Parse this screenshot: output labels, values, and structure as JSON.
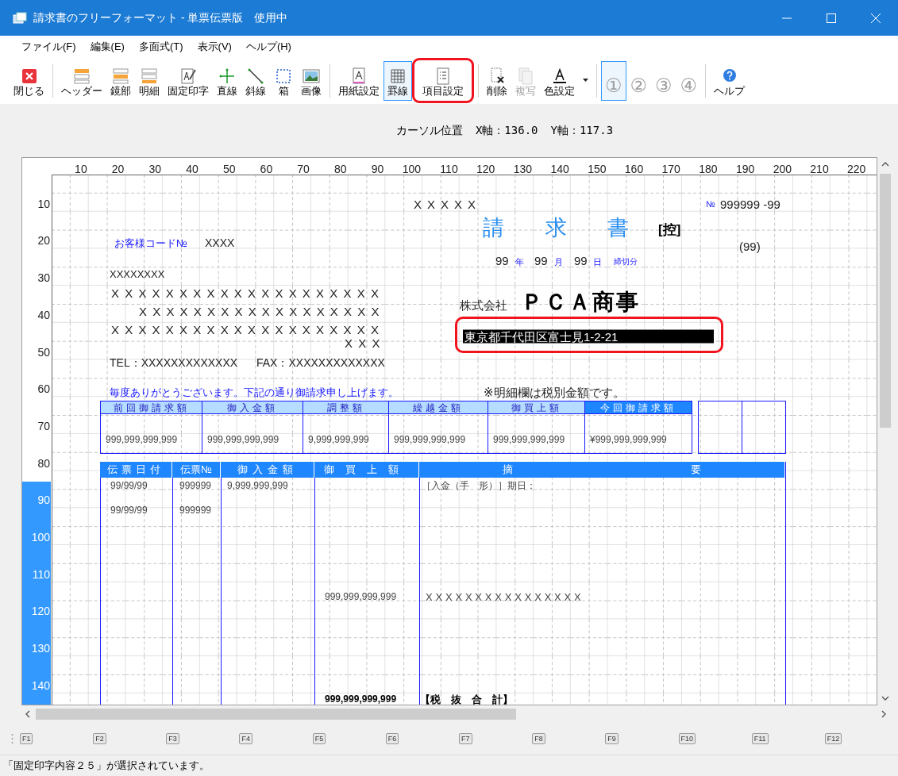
{
  "window": {
    "title": "請求書のフリーフォーマット - 単票伝票版　使用中"
  },
  "menu": [
    "ファイル(F)",
    "編集(E)",
    "多面式(T)",
    "表示(V)",
    "ヘルプ(H)"
  ],
  "toolbar": [
    {
      "label": "閉じる",
      "kind": "close",
      "disabled": false,
      "selected": false,
      "highlighted": false
    },
    {
      "label": "ヘッダー",
      "kind": "header",
      "disabled": false,
      "selected": false,
      "highlighted": false
    },
    {
      "label": "鏡部",
      "kind": "mirror",
      "disabled": false,
      "selected": false,
      "highlighted": false
    },
    {
      "label": "明細",
      "kind": "detail",
      "disabled": false,
      "selected": false,
      "highlighted": false
    },
    {
      "label": "固定印字",
      "kind": "fixed",
      "disabled": false,
      "selected": false,
      "highlighted": false
    },
    {
      "label": "直線",
      "kind": "line",
      "disabled": false,
      "selected": false,
      "highlighted": false
    },
    {
      "label": "斜線",
      "kind": "diagonal",
      "disabled": false,
      "selected": false,
      "highlighted": false
    },
    {
      "label": "箱",
      "kind": "box",
      "disabled": false,
      "selected": false,
      "highlighted": false
    },
    {
      "label": "画像",
      "kind": "image",
      "disabled": false,
      "selected": false,
      "highlighted": false
    },
    {
      "label": "用紙設定",
      "kind": "paper",
      "disabled": false,
      "selected": false,
      "highlighted": false
    },
    {
      "label": "罫線",
      "kind": "grid",
      "disabled": false,
      "selected": true,
      "highlighted": false
    },
    {
      "label": "項目設定",
      "kind": "items",
      "disabled": false,
      "selected": false,
      "highlighted": true
    },
    {
      "label": "削除",
      "kind": "delete",
      "disabled": false,
      "selected": false,
      "highlighted": false
    },
    {
      "label": "複写",
      "kind": "copy",
      "disabled": true,
      "selected": false,
      "highlighted": false
    },
    {
      "label": "色設定",
      "kind": "color",
      "disabled": false,
      "selected": false,
      "highlighted": false
    },
    {
      "kind": "dropdown",
      "disabled": false,
      "selected": false,
      "highlighted": false
    },
    {
      "label": "①",
      "kind": "number",
      "disabled": true,
      "selected": true,
      "highlighted": false
    },
    {
      "label": "②",
      "kind": "number",
      "disabled": true,
      "selected": false,
      "highlighted": false
    },
    {
      "label": "③",
      "kind": "number",
      "disabled": true,
      "selected": false,
      "highlighted": false
    },
    {
      "label": "④",
      "kind": "number",
      "disabled": true,
      "selected": false,
      "highlighted": false
    },
    {
      "label": "ヘルプ",
      "kind": "help",
      "disabled": false,
      "selected": false,
      "highlighted": false
    }
  ],
  "cursor_position": {
    "label": "カーソル位置",
    "x": "X軸：136.0",
    "y": "Y軸：117.3"
  },
  "ruler": {
    "x_labels": [
      "10",
      "20",
      "30",
      "40",
      "50",
      "60",
      "70",
      "80",
      "90",
      "100",
      "110",
      "120",
      "130",
      "140",
      "150",
      "160",
      "170",
      "180",
      "190",
      "200",
      "210",
      "220"
    ],
    "y_labels": [
      "10",
      "20",
      "30",
      "40",
      "50",
      "60",
      "70",
      "80",
      "90",
      "100",
      "110",
      "120",
      "130",
      "140"
    ]
  },
  "form": {
    "items": [
      {
        "text": "XXXXX",
        "kind": "value",
        "selected": false
      },
      {
        "text": "№",
        "kind": "caption",
        "selected": false
      },
      {
        "text": "999999 -99",
        "kind": "value",
        "selected": false
      },
      {
        "text": "請 求 書",
        "kind": "title",
        "selected": false
      },
      {
        "text": "[控]",
        "kind": "heading",
        "selected": false
      },
      {
        "text": "お客様コード№",
        "kind": "label",
        "selected": false
      },
      {
        "text": "XXXX",
        "kind": "value",
        "selected": false
      },
      {
        "text": "(99)",
        "kind": "value",
        "selected": false
      },
      {
        "text": "99",
        "kind": "value",
        "selected": false
      },
      {
        "text": "年",
        "kind": "caption",
        "selected": false
      },
      {
        "text": "99",
        "kind": "value",
        "selected": false
      },
      {
        "text": "月",
        "kind": "caption",
        "selected": false
      },
      {
        "text": "99",
        "kind": "value",
        "selected": false
      },
      {
        "text": "日",
        "kind": "caption",
        "selected": false
      },
      {
        "text": "締切分",
        "kind": "caption",
        "selected": false
      },
      {
        "text": "XXXXXXXX",
        "kind": "value",
        "selected": false
      },
      {
        "text": "XXXXXXXXXXXXXXXXXXXX",
        "kind": "value",
        "selected": false
      },
      {
        "text": "XXXXXXXXXXXXXXXXXX",
        "kind": "value",
        "selected": false
      },
      {
        "text": "XXXXXXXXXXXXXXXXXXXX",
        "kind": "value",
        "selected": false
      },
      {
        "text": "XXX",
        "kind": "value",
        "selected": false
      },
      {
        "text": "TEL：XXXXXXXXXXXXX",
        "kind": "value",
        "selected": false
      },
      {
        "text": "FAX：XXXXXXXXXXXXX",
        "kind": "value",
        "selected": false
      },
      {
        "text": "株式会社",
        "kind": "value",
        "selected": false
      },
      {
        "text": "ＰＣＡ商事",
        "kind": "company",
        "selected": false
      },
      {
        "text": "東京都千代田区富士見1-2-21",
        "kind": "value",
        "selected": true,
        "highlighted": true
      },
      {
        "text": "毎度ありがとうございます。下記の通り御請求申し上げます。",
        "kind": "label",
        "selected": false
      },
      {
        "text": "※明細欄は税別金額です。",
        "kind": "value",
        "selected": false
      },
      {
        "text": "99/99/99",
        "kind": "cell",
        "selected": false
      },
      {
        "text": "999999",
        "kind": "cell",
        "selected": false
      },
      {
        "text": "9,999,999,999",
        "kind": "cell",
        "selected": false
      },
      {
        "text": "［入金（手　形）］期日：",
        "kind": "cell",
        "selected": false
      },
      {
        "text": "99/99/99",
        "kind": "cell",
        "selected": false
      },
      {
        "text": "999999",
        "kind": "cell",
        "selected": false
      },
      {
        "text": "999,999,999,999",
        "kind": "cell",
        "selected": false
      },
      {
        "text": "XXXXXXXXXXXXXXXX",
        "kind": "cell",
        "selected": false
      },
      {
        "text": "999,999,999,999",
        "kind": "total",
        "selected": false
      },
      {
        "text": "【税　抜　合　計】",
        "kind": "total",
        "selected": false
      }
    ],
    "summary_table": {
      "columns": [
        {
          "header": "前回御請求額",
          "value": "999,999,999,999",
          "highlighted": false
        },
        {
          "header": "御入金額",
          "value": "999,999,999,999",
          "highlighted": false
        },
        {
          "header": "調整額",
          "value": "9,999,999,999",
          "highlighted": false
        },
        {
          "header": "繰越金額",
          "value": "999,999,999,999",
          "highlighted": false
        },
        {
          "header": "御買上額",
          "value": "999,999,999,999",
          "highlighted": false
        },
        {
          "header": "今回御請求額",
          "value": "¥999,999,999,999",
          "highlighted": true
        }
      ]
    },
    "detail_table": {
      "columns": [
        "伝票日付",
        "伝票№",
        "御入金額",
        "御買上額",
        "摘 要"
      ]
    }
  },
  "function_keys": [
    "F1",
    "F2",
    "F3",
    "F4",
    "F5",
    "F6",
    "F7",
    "F8",
    "F9",
    "F10",
    "F11",
    "F12"
  ],
  "status_bar": "「固定印字内容２５」が選択されています。"
}
